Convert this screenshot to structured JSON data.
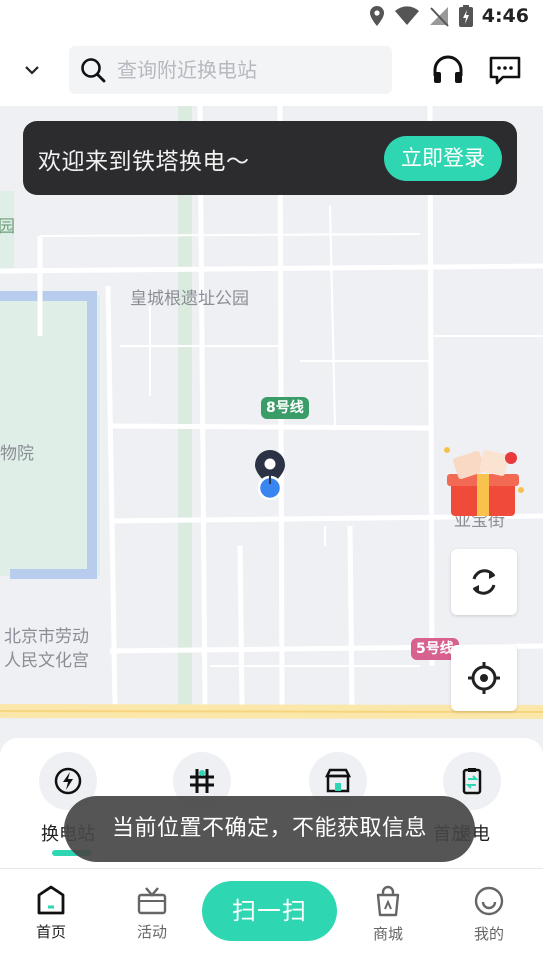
{
  "status_bar": {
    "time": "4:46"
  },
  "header": {
    "search_placeholder": "查询附近换电站"
  },
  "login_banner": {
    "message": "欢迎来到铁塔换电～",
    "button_label": "立即登录"
  },
  "map": {
    "labels": {
      "park": "皇城根遗址公园",
      "museum": "物院",
      "park_left": "园",
      "palace_line1": "北京市劳动",
      "palace_line2": "人民文化宫",
      "street": "亚宝街"
    },
    "lines": {
      "line8": "8号线",
      "line5": "5号线"
    },
    "line_colors": {
      "line8": "#3a9d67",
      "line5": "#d7618f"
    }
  },
  "functions": [
    {
      "label": "换电站",
      "icon": "lightning-icon"
    },
    {
      "label": "",
      "icon": "station-icon"
    },
    {
      "label": "",
      "icon": "store-icon"
    },
    {
      "label": "退电",
      "icon": "return-battery-icon"
    }
  ],
  "functions_partial_label": "首放",
  "toast": {
    "message": "当前位置不确定，不能获取信息"
  },
  "bottom_nav": {
    "home": "首页",
    "activity": "活动",
    "scan": "扫一扫",
    "mall": "商城",
    "mine": "我的"
  },
  "colors": {
    "accent": "#2fd6b2",
    "banner_bg": "#2c2c2e"
  }
}
